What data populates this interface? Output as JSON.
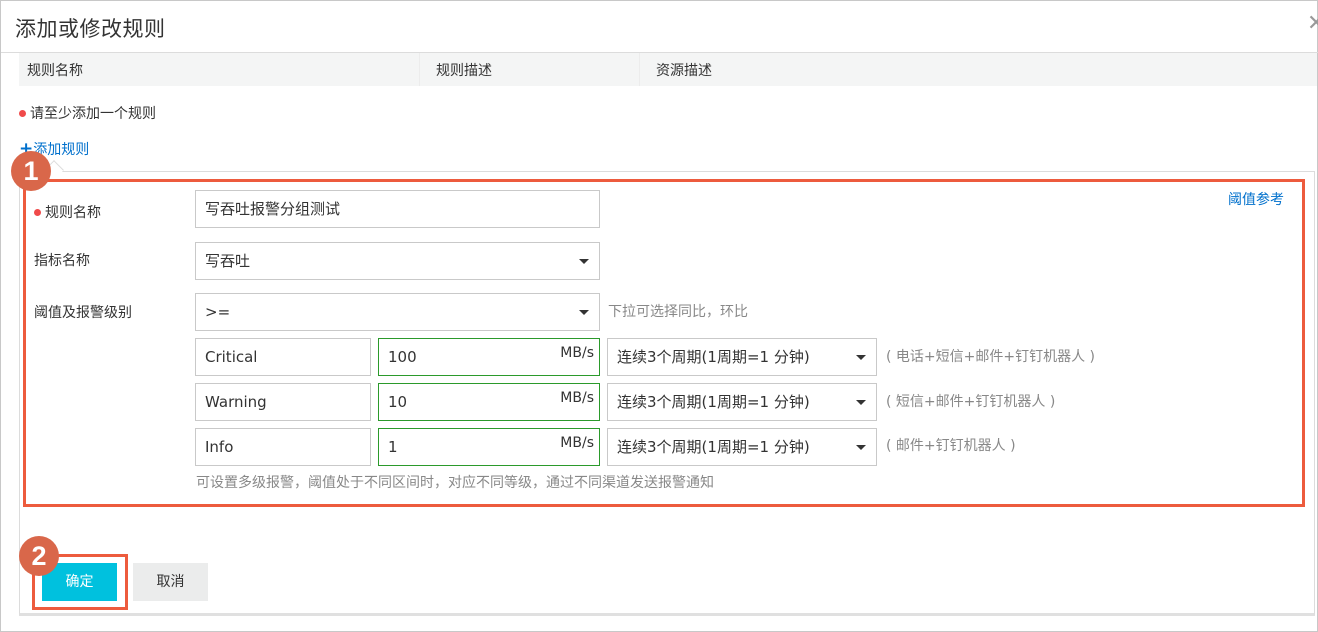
{
  "dialog": {
    "title": "添加或修改规则",
    "close_icon": "close-icon"
  },
  "rule_table": {
    "columns": [
      "规则名称",
      "规则描述",
      "资源描述"
    ]
  },
  "validation": {
    "message": "请至少添加一个规则"
  },
  "add_rule": {
    "plus": "+",
    "label": "添加规则"
  },
  "annotations": {
    "step1": "1",
    "step2": "2",
    "highlight_color": "#ed5b3d"
  },
  "form": {
    "threshold_reference_link": "阈值参考",
    "rule_name": {
      "label": "规则名称",
      "value": "写吞吐报警分组测试",
      "required": true
    },
    "metric_name": {
      "label": "指标名称",
      "value": "写吞吐"
    },
    "threshold": {
      "label": "阈值及报警级别",
      "operator": ">=",
      "operator_hint": "下拉可选择同比，环比",
      "levels": [
        {
          "level": "Critical",
          "value": "100",
          "unit": "MB/s",
          "period": "连续3个周期(1周期=1 分钟)",
          "channels": "( 电话+短信+邮件+钉钉机器人 )"
        },
        {
          "level": "Warning",
          "value": "10",
          "unit": "MB/s",
          "period": "连续3个周期(1周期=1 分钟)",
          "channels": "( 短信+邮件+钉钉机器人 )"
        },
        {
          "level": "Info",
          "value": "1",
          "unit": "MB/s",
          "period": "连续3个周期(1周期=1 分钟)",
          "channels": "( 邮件+钉钉机器人 )"
        }
      ],
      "levels_hint": "可设置多级报警，阈值处于不同区间时，对应不同等级，通过不同渠道发送报警通知"
    }
  },
  "buttons": {
    "confirm": "确定",
    "cancel": "取消",
    "confirm_color": "#00c1de"
  }
}
